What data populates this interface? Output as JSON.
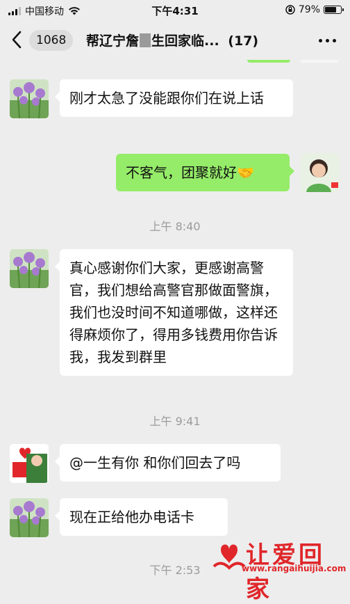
{
  "status_bar": {
    "carrier": "中国移动",
    "time": "下午4:31",
    "battery_percent": "79%",
    "battery_level": 0.79
  },
  "header": {
    "unread_count": "1068",
    "title_part1": "帮辽宁詹",
    "title_part2": "生回家临...",
    "member_count": "(17)"
  },
  "messages": [
    {
      "side": "left",
      "text": "刚才太急了没能跟你们在说上话"
    },
    {
      "side": "right",
      "text": "不客气，团聚就好🤝"
    },
    {
      "timestamp": "上午 8:40"
    },
    {
      "side": "left",
      "text": "真心感谢你们大家，更感谢高警官，我们想给高警官那做面警旗，我们也没时间不知道哪做，这样还得麻烦你了，得用多钱费用你告诉我，我发到群里"
    },
    {
      "timestamp": "上午 9:41"
    },
    {
      "side": "left",
      "text": "@一生有你 和你们回去了吗"
    },
    {
      "side": "left",
      "text": "现在正给他办电话卡"
    },
    {
      "timestamp": "下午 2:53"
    }
  ],
  "watermark": {
    "text": "让爱回家",
    "url": "www.rangaihuijia.com"
  },
  "icons": {
    "signal": "signal-bars-icon",
    "wifi": "wifi-icon",
    "lock": "rotation-lock-icon",
    "battery": "battery-icon",
    "back": "chevron-left-icon",
    "more": "ellipsis-icon"
  },
  "colors": {
    "background": "#ededed",
    "bubble_outgoing": "#95ec69",
    "bubble_incoming": "#ffffff",
    "watermark": "#e0262a"
  }
}
